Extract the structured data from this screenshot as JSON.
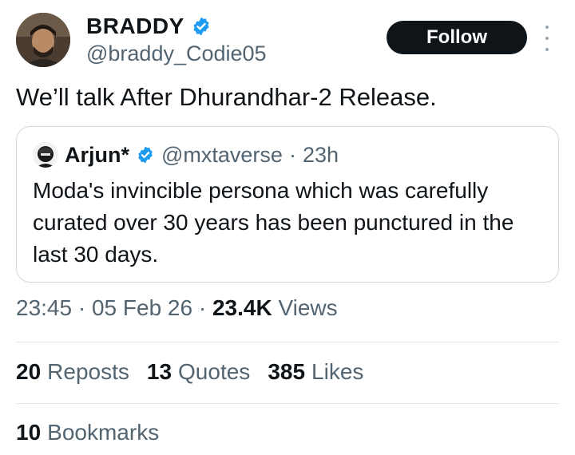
{
  "author": {
    "display_name": "BRADDY",
    "handle": "@braddy_Codie05",
    "verified_icon": "verified-badge-icon",
    "follow_label": "Follow"
  },
  "tweet": {
    "text": "We’ll talk After Dhurandhar-2 Release."
  },
  "quoted_tweet": {
    "name": "Arjun*",
    "handle": "@mxtaverse",
    "separator": "·",
    "time": "23h",
    "text": "Moda's invincible persona which was carefully curated over 30 years has been punctured in the last 30 days."
  },
  "meta": {
    "time": "23:45",
    "separator1": "·",
    "date": "05 Feb 26",
    "separator2": "·",
    "views_count": "23.4K",
    "views_label": "Views"
  },
  "stats": {
    "reposts_count": "20",
    "reposts_label": "Reposts",
    "quotes_count": "13",
    "quotes_label": "Quotes",
    "likes_count": "385",
    "likes_label": "Likes",
    "bookmarks_count": "10",
    "bookmarks_label": "Bookmarks"
  },
  "colors": {
    "verified_blue": "#1d9bf0",
    "text_primary": "#0f1419",
    "text_secondary": "#536471",
    "border": "#cfd9de"
  }
}
